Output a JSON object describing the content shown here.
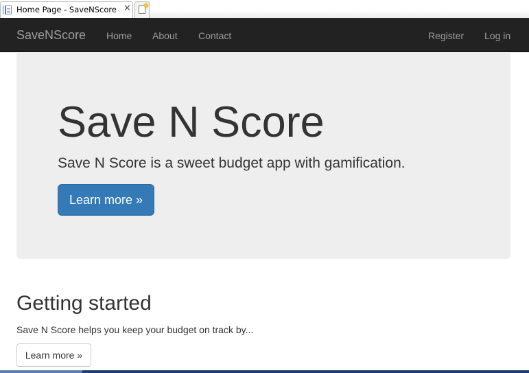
{
  "browser": {
    "tab_title": "Home Page - SaveNScore",
    "tab_close": "✕"
  },
  "navbar": {
    "brand": "SaveNScore",
    "links": [
      "Home",
      "About",
      "Contact"
    ],
    "right_links": [
      "Register",
      "Log in"
    ]
  },
  "jumbotron": {
    "title": "Save N Score",
    "lead": "Save N Score is a sweet budget app with gamification.",
    "button_label": "Learn more »"
  },
  "getting_started": {
    "title": "Getting started",
    "text": "Save N Score helps you keep your budget on track by...",
    "button_label": "Learn more »"
  },
  "colors": {
    "navbar_bg": "#222222",
    "nav_text": "#9d9d9d",
    "jumbotron_bg": "#eeeeee",
    "primary": "#337ab7"
  }
}
